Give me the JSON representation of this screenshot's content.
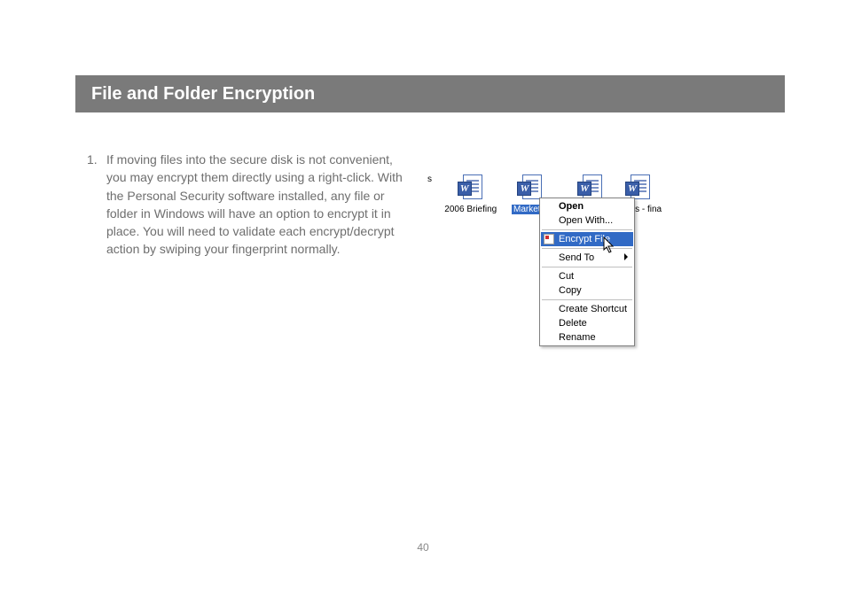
{
  "title": "File and Folder Encryption",
  "list_number": "1.",
  "paragraph": "If moving files into the secure disk is not convenient, you may encrypt them directly using a right-click.  With the Personal Security software installed, any file or folder in Windows will have an option to encrypt it in place.  You will need to validate each encrypt/decrypt action by swiping your fingerprint normally.",
  "files": {
    "left_edge": "s",
    "f1": "2006 Briefing",
    "f2_selected": "Market u",
    "right_edge": "pecs - fina"
  },
  "menu": {
    "open": "Open",
    "open_with": "Open With...",
    "encrypt": "Encrypt File",
    "send_to": "Send To",
    "cut": "Cut",
    "copy": "Copy",
    "create_shortcut": "Create Shortcut",
    "delete": "Delete",
    "rename": "Rename"
  },
  "page_number": "40"
}
